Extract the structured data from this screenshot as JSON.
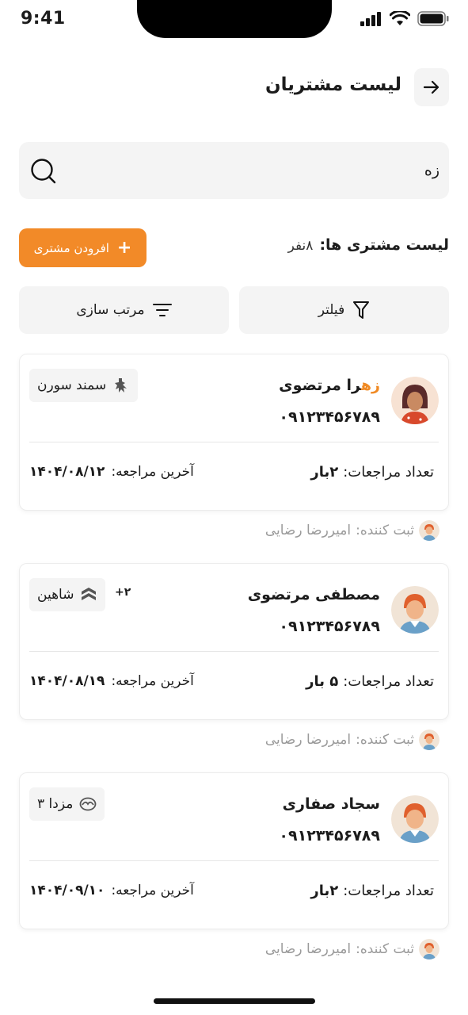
{
  "status_bar": {
    "time": "9:41"
  },
  "header": {
    "title": "لیست مشتریان",
    "back_icon": "arrow-right-icon"
  },
  "search": {
    "value": "زه",
    "placeholder": ""
  },
  "list_summary": {
    "label": "لیست مشتری ها:",
    "count": "۸نفر"
  },
  "add_button": {
    "label": "افرودن مشتری",
    "icon": "plus-icon"
  },
  "filter_button": {
    "label": "فیلتر",
    "icon": "filter-icon"
  },
  "sort_button": {
    "label": "مرتب سازی",
    "icon": "sort-icon"
  },
  "customers": [
    {
      "name_highlight": "زه",
      "name_rest": "را مرتضوی",
      "phone": "۰۹۱۲۳۴۵۶۷۸۹",
      "car": "سمند سورن",
      "car_icon": "peugeot-logo-icon",
      "extra": "",
      "visits_label": "تعداد مراجعات:",
      "visits_value": "۲بار",
      "last_label": "آخرین مراجعه:",
      "last_value": "۱۴۰۴/۰۸/۱۲",
      "creator_label": "ثبت کننده:",
      "creator_name": "امیررضا رضایی"
    },
    {
      "name_highlight": "",
      "name_rest": "مصطفی مرتضوی",
      "phone": "۰۹۱۲۳۴۵۶۷۸۹",
      "car": "شاهین",
      "car_icon": "saipa-logo-icon",
      "extra": "+۲",
      "visits_label": "تعداد مراجعات:",
      "visits_value": "۵ بار",
      "last_label": "آخرین مراجعه:",
      "last_value": "۱۴۰۴/۰۸/۱۹",
      "creator_label": "ثبت کننده:",
      "creator_name": "امیررضا رضایی"
    },
    {
      "name_highlight": "",
      "name_rest": "سجاد صفاری",
      "phone": "۰۹۱۲۳۴۵۶۷۸۹",
      "car": "مزدا ۳",
      "car_icon": "mazda-logo-icon",
      "extra": "",
      "visits_label": "تعداد مراجعات:",
      "visits_value": "۲بار",
      "last_label": "آخرین مراجعه:",
      "last_value": "۱۴۰۴/۰۹/۱۰",
      "creator_label": "ثبت کننده:",
      "creator_name": "امیررضا رضایی"
    }
  ],
  "colors": {
    "accent": "#f28a28",
    "surface": "#f4f4f4",
    "muted_text": "#9a9a9a"
  }
}
